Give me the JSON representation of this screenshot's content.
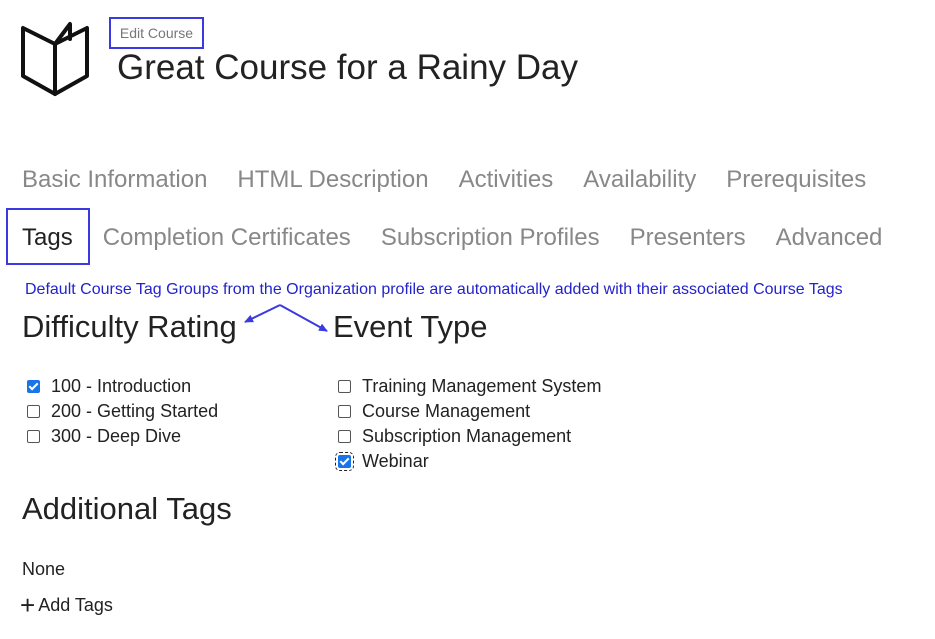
{
  "header": {
    "subtitle": "Edit Course",
    "title": "Great Course for a Rainy Day"
  },
  "tabs_row1": [
    "Basic Information",
    "HTML Description",
    "Activities",
    "Availability",
    "Prerequisites"
  ],
  "tabs_row2": [
    "Tags",
    "Completion Certificates",
    "Subscription Profiles",
    "Presenters",
    "Advanced"
  ],
  "active_tab": "Tags",
  "note": "Default Course Tag Groups from the Organization profile are automatically added with their associated Course Tags",
  "difficulty": {
    "heading": "Difficulty Rating",
    "items": [
      {
        "label": "100 - Introduction",
        "checked": true
      },
      {
        "label": "200 - Getting Started",
        "checked": false
      },
      {
        "label": "300 - Deep Dive",
        "checked": false
      }
    ]
  },
  "event_type": {
    "heading": "Event Type",
    "items": [
      {
        "label": "Training Management System",
        "checked": false
      },
      {
        "label": "Course Management",
        "checked": false
      },
      {
        "label": "Subscription Management",
        "checked": false
      },
      {
        "label": "Webinar",
        "checked": true
      }
    ]
  },
  "additional": {
    "heading": "Additional Tags",
    "none_text": "None",
    "add_label": "Add Tags"
  },
  "colors": {
    "annotation": "#3a3ae0",
    "note_text": "#2323cc",
    "checkbox_checked": "#1a73e8"
  },
  "icons": {
    "logo": "open-book-icon",
    "add": "plus-icon"
  }
}
